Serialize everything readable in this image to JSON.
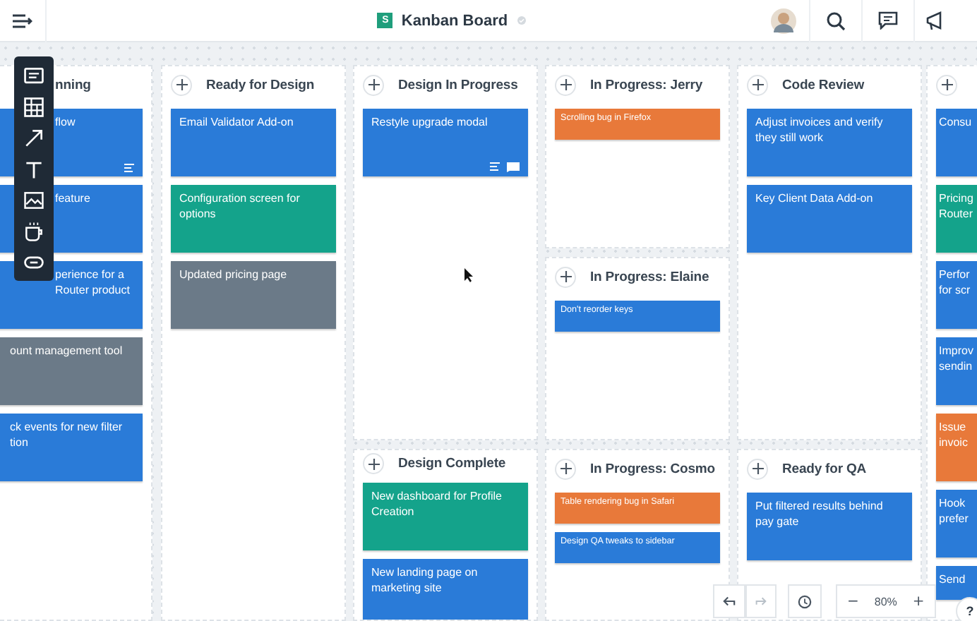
{
  "header": {
    "board_badge": "S",
    "title": "Kanban Board"
  },
  "columns": [
    {
      "title": "nning",
      "compact": false,
      "cards": [
        {
          "text": "flow",
          "color": "#2a7bd8",
          "description": true
        },
        {
          "text": "feature",
          "color": "#2a7bd8"
        },
        {
          "text": "perience for a Router product",
          "color": "#2a7bd8"
        },
        {
          "text": "ount management tool",
          "color": "#6b7a88"
        },
        {
          "text": "ck events for new filter tion",
          "color": "#2a7bd8"
        }
      ]
    },
    {
      "title": "Ready for Design",
      "compact": false,
      "cards": [
        {
          "text": "Email Validator Add-on",
          "color": "#2a7bd8"
        },
        {
          "text": "Configuration screen for options",
          "color": "#14a38b"
        },
        {
          "text": "Updated pricing page",
          "color": "#6b7a88"
        }
      ]
    },
    {
      "title": "Design In Progress",
      "compact": false,
      "cards": [
        {
          "text": "Restyle upgrade modal",
          "color": "#2a7bd8",
          "description": true,
          "comments": true
        }
      ]
    },
    {
      "title": "In Progress: Jerry",
      "compact": true,
      "cards": [
        {
          "text": "Scrolling bug in Firefox",
          "color": "#e8793a"
        }
      ]
    },
    {
      "title": "In Progress: Elaine",
      "compact": true,
      "cards": [
        {
          "text": "Don't reorder keys",
          "color": "#2a7bd8"
        }
      ]
    },
    {
      "title": "Code Review",
      "compact": false,
      "cards": [
        {
          "text": "Adjust invoices and verify they still work",
          "color": "#2a7bd8"
        },
        {
          "text": "Key Client Data Add-on",
          "color": "#2a7bd8"
        }
      ]
    },
    {
      "title": "Design Complete",
      "compact": false,
      "cards": [
        {
          "text": "New dashboard for Profile Creation",
          "color": "#14a38b"
        },
        {
          "text": "New landing page on marketing site",
          "color": "#2a7bd8"
        }
      ]
    },
    {
      "title": "In Progress: Cosmo",
      "compact": true,
      "cards": [
        {
          "text": "Table rendering bug in Safari",
          "color": "#e8793a"
        },
        {
          "text": "Design QA tweaks to sidebar",
          "color": "#2a7bd8"
        }
      ]
    },
    {
      "title": "Ready for QA",
      "compact": false,
      "cards": [
        {
          "text": "Put filtered results behind pay gate",
          "color": "#2a7bd8"
        }
      ]
    },
    {
      "compact": false,
      "cards": [
        {
          "text": "Consu",
          "color": "#2a7bd8"
        },
        {
          "text": "Pricing Router",
          "color": "#14a38b"
        },
        {
          "text": "Perfor for scr",
          "color": "#2a7bd8"
        },
        {
          "text": "Improv sendin",
          "color": "#2a7bd8"
        },
        {
          "text": "Issue invoic",
          "color": "#e8793a"
        },
        {
          "text": "Hook prefer",
          "color": "#2a7bd8"
        },
        {
          "text": "Send",
          "color": "#2a7bd8"
        }
      ]
    }
  ],
  "zoom": {
    "minus": "−",
    "value": "80%",
    "plus": "+"
  },
  "help": "?"
}
